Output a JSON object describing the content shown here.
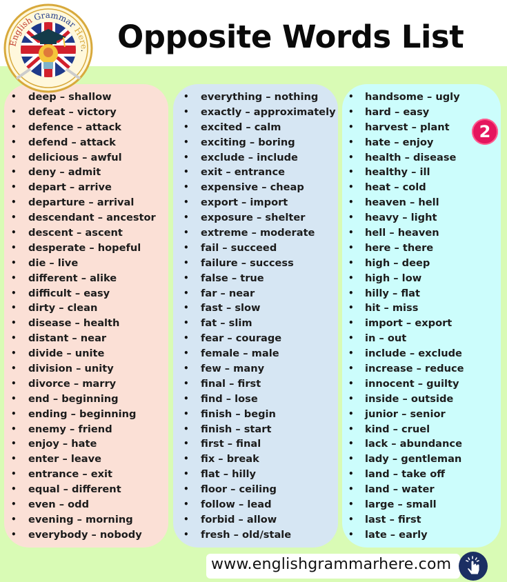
{
  "header": {
    "title": "Opposite Words List",
    "logo": {
      "text_top": "English Grammar Here.Com",
      "icon": "graduation-cap-lightbulb-union-jack-logo"
    }
  },
  "page_badge": "2",
  "columns": [
    {
      "color": "#fbe0d6",
      "items": [
        "deep – shallow",
        "defeat – victory",
        "defence – attack",
        "defend – attack",
        "delicious – awful",
        "deny – admit",
        "depart – arrive",
        "departure – arrival",
        "descendant – ancestor",
        "descent – ascent",
        "desperate – hopeful",
        "die – live",
        "different – alike",
        "difficult – easy",
        "dirty – clean",
        "disease – health",
        "distant – near",
        "divide – unite",
        "division – unity",
        "divorce – marry",
        "end – beginning",
        "ending – beginning",
        "enemy – friend",
        "enjoy – hate",
        "enter – leave",
        "entrance – exit",
        "equal – different",
        "even – odd",
        "evening – morning",
        "everybody – nobody"
      ]
    },
    {
      "color": "#d6e6f3",
      "items": [
        "everything – nothing",
        "exactly – approximately",
        "excited – calm",
        "exciting – boring",
        "exclude – include",
        "exit – entrance",
        "expensive – cheap",
        "export – import",
        "exposure – shelter",
        "extreme – moderate",
        "fail – succeed",
        "failure – success",
        "false – true",
        "far – near",
        "fast – slow",
        "fat – slim",
        "fear – courage",
        "female – male",
        "few – many",
        "final – first",
        "find – lose",
        "finish – begin",
        "finish – start",
        "first – final",
        "fix – break",
        "flat – hilly",
        "floor – ceiling",
        "follow – lead",
        "forbid – allow",
        "fresh – old/stale"
      ]
    },
    {
      "color": "#ccfdfc",
      "items": [
        "handsome – ugly",
        "hard – easy",
        "harvest – plant",
        "hate – enjoy",
        "health – disease",
        "healthy – ill",
        "heat – cold",
        "heaven – hell",
        "heavy – light",
        "hell – heaven",
        "here – there",
        "high – deep",
        "high – low",
        "hilly – flat",
        "hit – miss",
        "import – export",
        "in – out",
        "include – exclude",
        "increase – reduce",
        "innocent – guilty",
        "inside – outside",
        "junior – senior",
        "kind – cruel",
        "lack – abundance",
        "lady – gentleman",
        "land – take off",
        "land – water",
        "large – small",
        "last – first",
        "late – early"
      ]
    }
  ],
  "footer": {
    "url": "www.englishgrammarhere.com",
    "icon": "hand-pointer-click-icon"
  },
  "colors": {
    "background": "#d9fbb5",
    "badge": "#e5155e",
    "footer_icon": "#1b2f63"
  }
}
